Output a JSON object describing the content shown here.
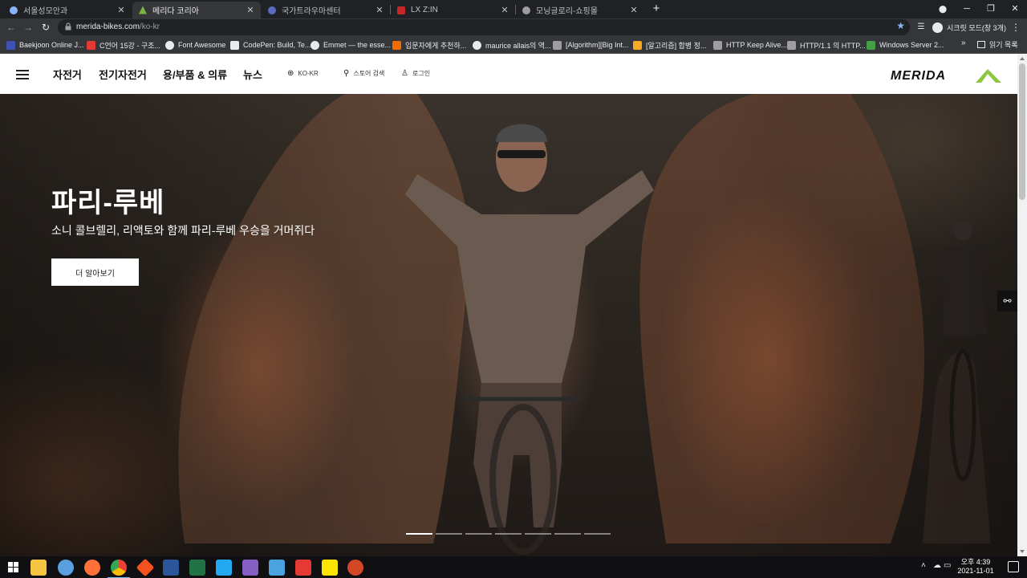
{
  "browser": {
    "tabs": [
      {
        "title": "서울성모안과",
        "color": "#8ab4f8",
        "active": false
      },
      {
        "title": "메리다 코리아",
        "color": "#7cb342",
        "active": true
      },
      {
        "title": "국가트라우마센터",
        "color": "#5c6bc0",
        "active": false
      },
      {
        "title": "LX Z:IN",
        "color": "#c62828",
        "active": false
      },
      {
        "title": "모닝글로리-쇼핑몰",
        "color": "#9e9e9e",
        "active": false
      }
    ],
    "url": {
      "host": "merida-bikes.com",
      "path": "/ko-kr"
    },
    "incognito_label": "시크릿 모드(창 3개)",
    "bookmarks": [
      {
        "label": "Baekjoon Online J...",
        "color": "#3f51b5"
      },
      {
        "label": "C언어 15강 - 구조...",
        "color": "#e53935"
      },
      {
        "label": "Font Awesome",
        "color": "#e8eaed"
      },
      {
        "label": "CodePen: Build, Te...",
        "color": "#e8eaed"
      },
      {
        "label": "Emmet — the esse...",
        "color": "#e8eaed"
      },
      {
        "label": "입문자에게 추천하...",
        "color": "#ef6c00"
      },
      {
        "label": "maurice allais의 역...",
        "color": "#e8eaed"
      },
      {
        "label": "[Algorithm][Big Int...",
        "color": "#9e9e9e"
      },
      {
        "label": "[알고리즘] 합병 정...",
        "color": "#f9a825"
      },
      {
        "label": "HTTP Keep Alive...",
        "color": "#9e9e9e"
      },
      {
        "label": "HTTP/1.1 의 HTTP...",
        "color": "#9e9e9e"
      },
      {
        "label": "Windows Server 2...",
        "color": "#43a047"
      }
    ],
    "bookmarks_more": "»",
    "reading_list": "읽기 목록"
  },
  "site": {
    "nav": [
      "자전거",
      "전기자전거",
      "용/부품 & 의류",
      "뉴스"
    ],
    "locale": "KO-KR",
    "store_search": "스토어 검색",
    "login": "로그인",
    "logo": "MERIDA",
    "hero": {
      "title": "파리-루베",
      "subtitle": "소니 콜브렐리, 리액토와 함께 파리-루베 우승을 거머쥐다",
      "button": "더 알아보기",
      "slide_count": 7,
      "active_slide": 1
    }
  },
  "taskbar": {
    "apps": [
      {
        "name": "file-explorer",
        "color": "#f5c542"
      },
      {
        "name": "pinned-app",
        "color": "#5aa0e0"
      },
      {
        "name": "firefox",
        "color": "#ff7139"
      },
      {
        "name": "chrome",
        "color": "#4caf50",
        "active": true
      },
      {
        "name": "git",
        "color": "#f4511e"
      },
      {
        "name": "word",
        "color": "#2b579a"
      },
      {
        "name": "excel",
        "color": "#217346"
      },
      {
        "name": "vscode",
        "color": "#23a9f2"
      },
      {
        "name": "visual-studio",
        "color": "#865fc5"
      },
      {
        "name": "pinned-app-2",
        "color": "#4aa3df"
      },
      {
        "name": "acrobat",
        "color": "#e53935"
      },
      {
        "name": "kakaotalk",
        "color": "#fee500"
      },
      {
        "name": "powerpoint",
        "color": "#d24726"
      }
    ],
    "time": "오후 4:39",
    "date": "2021-11-01"
  },
  "colors": {
    "logo_green": "#8dc63f",
    "active_tab": "#35363a"
  }
}
